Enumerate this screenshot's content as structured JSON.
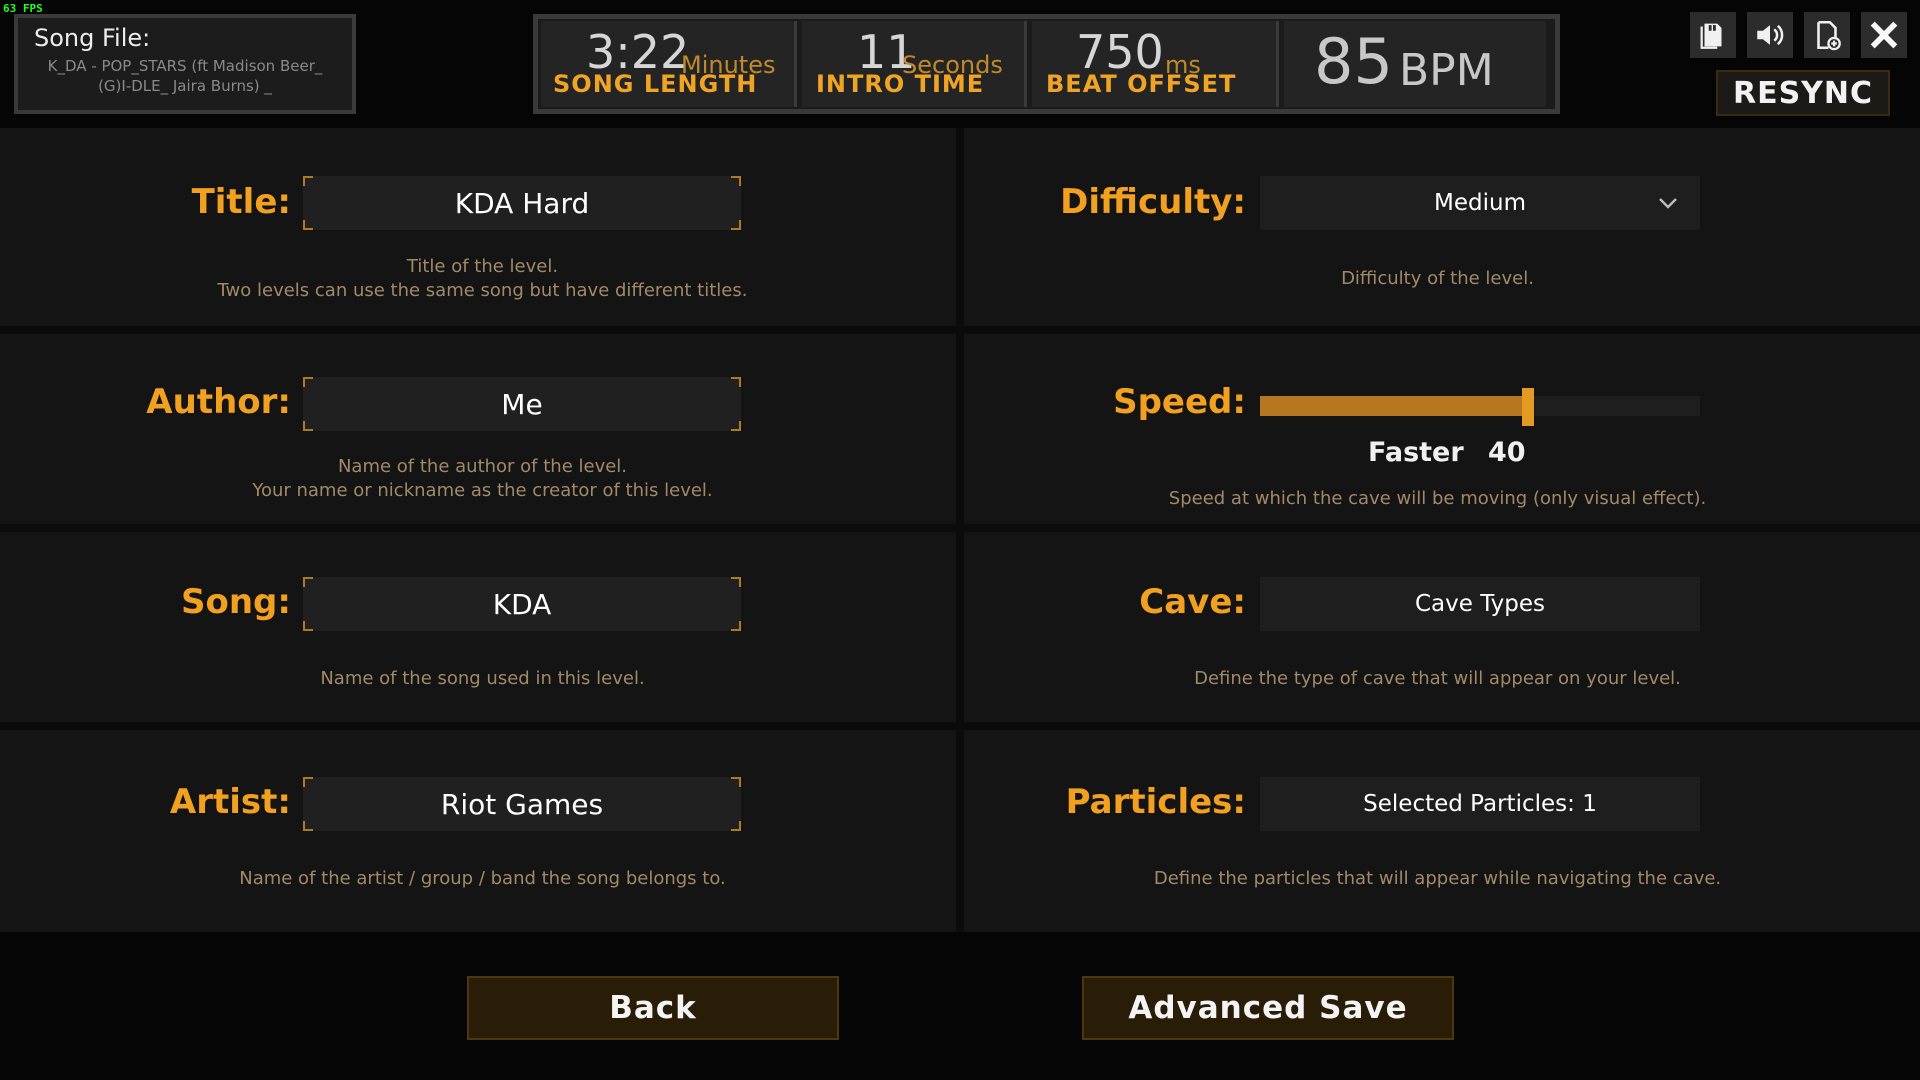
{
  "fps": "63 FPS",
  "song_file": {
    "label": "Song File:",
    "value": "K_DA - POP_STARS (ft Madison Beer_ (G)I-DLE_ Jaira Burns) _"
  },
  "stats": {
    "song_length": {
      "value": "3:22",
      "unit": "Minutes",
      "caption": "SONG LENGTH"
    },
    "intro_time": {
      "value": "11",
      "unit": "Seconds",
      "caption": "INTRO TIME"
    },
    "beat_offset": {
      "value": "750",
      "unit": "ms",
      "caption": "BEAT OFFSET"
    },
    "bpm": {
      "value": "85",
      "unit": "BPM"
    }
  },
  "toolbar": {
    "icons": [
      "file-copy-icon",
      "speaker-icon",
      "add-file-icon",
      "close-icon"
    ],
    "resync_label": "RESYNC"
  },
  "form": {
    "title": {
      "label": "Title:",
      "value": "KDA Hard",
      "desc": [
        "Title of the level.",
        "Two levels can use the same song but have different titles."
      ]
    },
    "author": {
      "label": "Author:",
      "value": "Me",
      "desc": [
        "Name of the author of the level.",
        "Your name or nickname as the creator of this level."
      ]
    },
    "song": {
      "label": "Song:",
      "value": "KDA",
      "desc": [
        "Name of the song used in this level."
      ]
    },
    "artist": {
      "label": "Artist:",
      "value": "Riot Games",
      "desc": [
        "Name of the artist / group / band the song belongs to."
      ]
    },
    "difficulty": {
      "label": "Difficulty:",
      "value": "Medium",
      "desc": [
        "Difficulty of the level."
      ]
    },
    "speed": {
      "label": "Speed:",
      "value_label": "Faster",
      "value": "40",
      "fraction": 0.61,
      "desc": [
        "Speed at which the cave will be moving (only visual effect)."
      ]
    },
    "cave": {
      "label": "Cave:",
      "value": "Cave Types",
      "desc": [
        "Define the type of cave that will appear on your level."
      ]
    },
    "particles": {
      "label": "Particles:",
      "value": "Selected Particles: 1",
      "desc": [
        "Define the particles that will appear while navigating the cave."
      ]
    }
  },
  "buttons": {
    "back": "Back",
    "advanced_save": "Advanced Save"
  },
  "colors": {
    "accent": "#f2a020",
    "button_bg": "#2a1d08"
  }
}
